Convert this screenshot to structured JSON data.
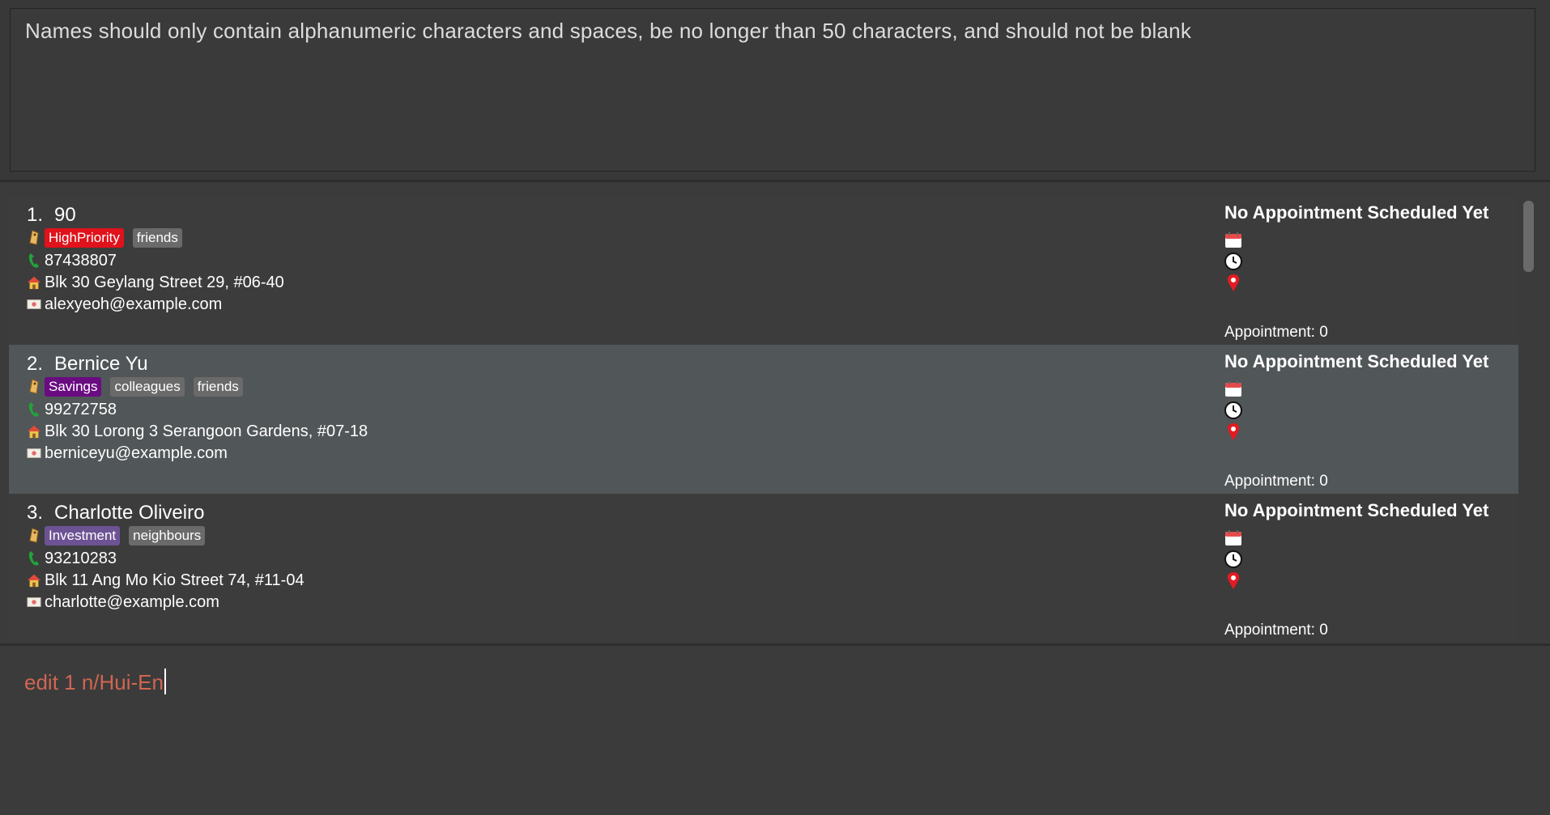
{
  "result_display": {
    "message": "Names should only contain alphanumeric characters and spaces, be no longer than 50 characters, and should not be blank"
  },
  "persons": [
    {
      "index": "1.",
      "name": "90",
      "tags": [
        {
          "label": "HighPriority",
          "color": "#e0121b"
        },
        {
          "label": "friends",
          "color": "#6b6b6b"
        }
      ],
      "phone": "87438807",
      "address": "Blk 30 Geylang Street 29, #06-40",
      "email": "alexyeoh@example.com",
      "appointment_title": "No Appointment Scheduled Yet",
      "appointment_count": "Appointment: 0"
    },
    {
      "index": "2.",
      "name": "Bernice Yu",
      "tags": [
        {
          "label": "Savings",
          "color": "#6a0b82"
        },
        {
          "label": "colleagues",
          "color": "#6b6b6b"
        },
        {
          "label": "friends",
          "color": "#6b6b6b"
        }
      ],
      "phone": "99272758",
      "address": "Blk 30 Lorong 3 Serangoon Gardens, #07-18",
      "email": "berniceyu@example.com",
      "appointment_title": "No Appointment Scheduled Yet",
      "appointment_count": "Appointment: 0"
    },
    {
      "index": "3.",
      "name": "Charlotte Oliveiro",
      "tags": [
        {
          "label": "Investment",
          "color": "#6d5394"
        },
        {
          "label": "neighbours",
          "color": "#6b6b6b"
        }
      ],
      "phone": "93210283",
      "address": "Blk 11 Ang Mo Kio Street 74, #11-04",
      "email": "charlotte@example.com",
      "appointment_title": "No Appointment Scheduled Yet",
      "appointment_count": "Appointment: 0"
    }
  ],
  "command_box": {
    "value": "edit 1 n/Hui-En"
  },
  "icons": {
    "tag": "tag-icon",
    "phone": "phone-icon",
    "address": "house-icon",
    "email": "envelope-icon",
    "date": "calendar-icon",
    "time": "clock-icon",
    "location": "location-pin-icon"
  }
}
